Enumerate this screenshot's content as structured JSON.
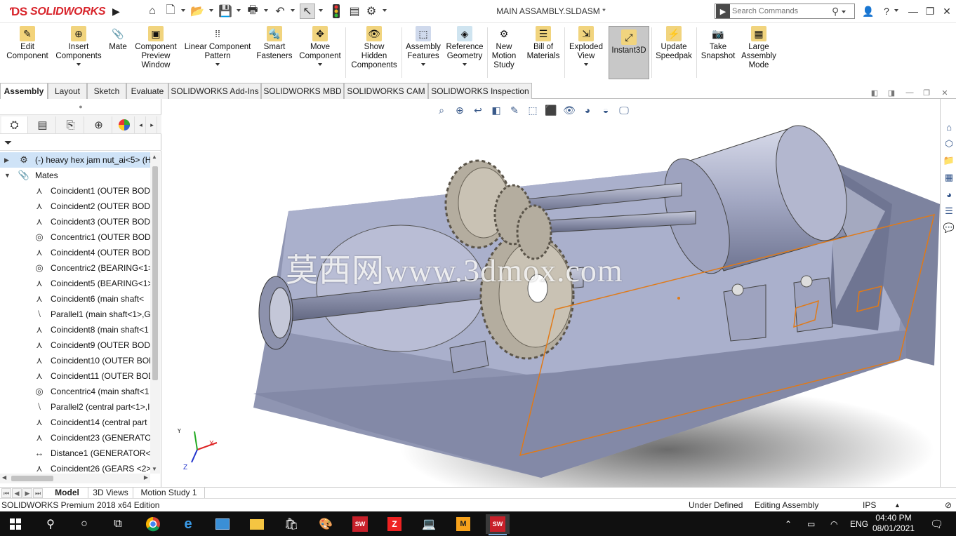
{
  "app": {
    "logo_text": "SOLIDWORKS",
    "document_title": "MAIN ASSAMBLY.SLDASM *"
  },
  "search": {
    "placeholder": "Search Commands"
  },
  "ribbon": {
    "buttons": [
      {
        "label": "Edit\nComponent",
        "icon": "edit-component-icon"
      },
      {
        "label": "Insert\nComponents",
        "icon": "insert-components-icon"
      },
      {
        "label": "Mate",
        "icon": "mate-icon"
      },
      {
        "label": "Component\nPreview\nWindow",
        "icon": "preview-window-icon"
      },
      {
        "label": "Linear Component\nPattern",
        "icon": "linear-pattern-icon"
      },
      {
        "label": "Smart\nFasteners",
        "icon": "smart-fasteners-icon"
      },
      {
        "label": "Move\nComponent",
        "icon": "move-component-icon"
      },
      {
        "label": "Show\nHidden\nComponents",
        "icon": "show-hidden-icon"
      },
      {
        "label": "Assembly\nFeatures",
        "icon": "assembly-features-icon"
      },
      {
        "label": "Reference\nGeometry",
        "icon": "reference-geometry-icon"
      },
      {
        "label": "New\nMotion\nStudy",
        "icon": "motion-study-icon"
      },
      {
        "label": "Bill of\nMaterials",
        "icon": "bom-icon"
      },
      {
        "label": "Exploded\nView",
        "icon": "exploded-view-icon"
      },
      {
        "label": "Instant3D",
        "icon": "instant3d-icon"
      },
      {
        "label": "Update\nSpeedpak",
        "icon": "speedpak-icon"
      },
      {
        "label": "Take\nSnapshot",
        "icon": "snapshot-icon"
      },
      {
        "label": "Large\nAssembly\nMode",
        "icon": "large-assembly-icon"
      }
    ]
  },
  "command_tabs": [
    "Assembly",
    "Layout",
    "Sketch",
    "Evaluate",
    "SOLIDWORKS Add-Ins",
    "SOLIDWORKS MBD",
    "SOLIDWORKS CAM",
    "SOLIDWORKS Inspection"
  ],
  "tree": {
    "items": [
      {
        "text": "(-) heavy hex jam nut_ai<5> (H",
        "type": "part"
      },
      {
        "text": "Mates",
        "type": "folder"
      },
      {
        "text": "Coincident1 (OUTER BODY",
        "type": "coincident"
      },
      {
        "text": "Coincident2 (OUTER BODY",
        "type": "coincident"
      },
      {
        "text": "Coincident3 (OUTER BODY",
        "type": "coincident"
      },
      {
        "text": "Concentric1 (OUTER BODY",
        "type": "concentric"
      },
      {
        "text": "Coincident4 (OUTER BODY",
        "type": "coincident"
      },
      {
        "text": "Concentric2 (BEARING<1>",
        "type": "concentric"
      },
      {
        "text": "Coincident5 (BEARING<1>",
        "type": "coincident"
      },
      {
        "text": "Coincident6 (main shaft<",
        "type": "coincident"
      },
      {
        "text": "Parallel1 (main shaft<1>,G",
        "type": "parallel"
      },
      {
        "text": "Coincident8 (main shaft<1",
        "type": "coincident"
      },
      {
        "text": "Coincident9 (OUTER BODY",
        "type": "coincident"
      },
      {
        "text": "Coincident10 (OUTER BOD",
        "type": "coincident"
      },
      {
        "text": "Coincident11 (OUTER BOD",
        "type": "coincident"
      },
      {
        "text": "Concentric4 (main shaft<1",
        "type": "concentric"
      },
      {
        "text": "Parallel2 (central part<1>,I",
        "type": "parallel"
      },
      {
        "text": "Coincident14 (central part",
        "type": "coincident"
      },
      {
        "text": "Coincident23 (GENERATOI",
        "type": "coincident"
      },
      {
        "text": "Distance1 (GENERATOR<1",
        "type": "distance"
      },
      {
        "text": "Coincident26 (GEARS <2>",
        "type": "coincident"
      }
    ]
  },
  "viewport": {
    "watermark": "莫西网www.3dmox.com",
    "triad": {
      "x": "X",
      "y": "Y",
      "z": "Z"
    }
  },
  "bottom_tabs": [
    "Model",
    "3D Views",
    "Motion Study 1"
  ],
  "status": {
    "edition": "SOLIDWORKS Premium 2018 x64 Edition",
    "defined": "Under Defined",
    "mode": "Editing Assembly",
    "units": "IPS"
  },
  "taskbar": {
    "language": "ENG",
    "time": "04:40 PM",
    "date": "08/01/2021"
  },
  "colors": {
    "brand": "#d8232a",
    "model_body": "#9aa0bf",
    "gear": "#b8b1a5",
    "sketch": "#e07a18",
    "taskbar": "#101010"
  }
}
